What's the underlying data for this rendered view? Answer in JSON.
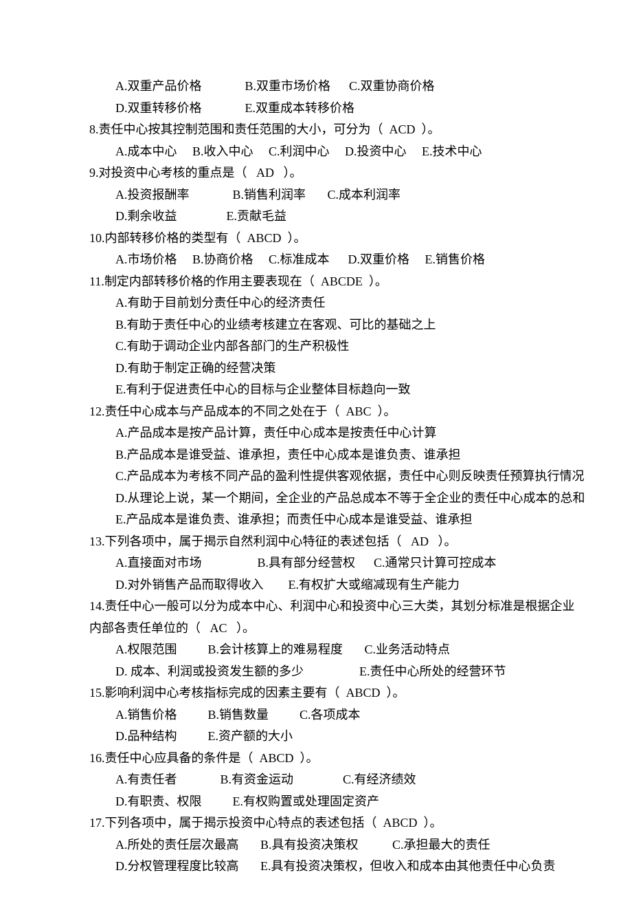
{
  "lines": [
    {
      "indent": true,
      "text": "A.双重产品价格              B.双重市场价格      C.双重协商价格"
    },
    {
      "indent": true,
      "text": "D.双重转移价格              E.双重成本转移价格"
    },
    {
      "indent": false,
      "text": "8.责任中心按其控制范围和责任范围的大小，可分为（  ACD  ）。"
    },
    {
      "indent": true,
      "text": "A.成本中心     B.收入中心     C.利润中心     D.投资中心     E.技术中心"
    },
    {
      "indent": false,
      "text": "9.对投资中心考核的重点是（   AD   ）。"
    },
    {
      "indent": true,
      "text": "A.投资报酬率              B.销售利润率       C.成本利润率"
    },
    {
      "indent": true,
      "text": "D.剩余收益                E.贡献毛益"
    },
    {
      "indent": false,
      "text": "10.内部转移价格的类型有（  ABCD  ）。"
    },
    {
      "indent": true,
      "text": "A.市场价格     B.协商价格     C.标准成本      D.双重价格     E.销售价格"
    },
    {
      "indent": false,
      "text": "11.制定内部转移价格的作用主要表现在（  ABCDE  ）。"
    },
    {
      "indent": true,
      "text": "A.有助于目前划分责任中心的经济责任"
    },
    {
      "indent": true,
      "text": "B.有助于责任中心的业绩考核建立在客观、可比的基础之上"
    },
    {
      "indent": true,
      "text": "C.有助于调动企业内部各部门的生产积极性"
    },
    {
      "indent": true,
      "text": "D.有助于制定正确的经营决策"
    },
    {
      "indent": true,
      "text": "E.有利于促进责任中心的目标与企业整体目标趋向一致"
    },
    {
      "indent": false,
      "text": "12.责任中心成本与产品成本的不同之处在于（  ABC  ）。"
    },
    {
      "indent": true,
      "text": "A.产品成本是按产品计算，责任中心成本是按责任中心计算"
    },
    {
      "indent": true,
      "text": "B.产品成本是谁受益、谁承担，责任中心成本是谁负责、谁承担"
    },
    {
      "indent": true,
      "text": "C.产品成本为考核不同产品的盈利性提供客观依据，责任中心则反映责任预算执行情况"
    },
    {
      "indent": true,
      "text": "D.从理论上说，某一个期间，全企业的产品总成本不等于全企业的责任中心成本的总和"
    },
    {
      "indent": true,
      "text": "E.产品成本是谁负责、谁承担；而责任中心成本是谁受益、谁承担"
    },
    {
      "indent": false,
      "text": "13.下列各项中，属于揭示自然利润中心特征的表述包括（   AD   ）。"
    },
    {
      "indent": true,
      "text": "A.直接面对市场                  B.具有部分经营权      C.通常只计算可控成本"
    },
    {
      "indent": true,
      "text": "D.对外销售产品而取得收入        E.有权扩大或缩减现有生产能力"
    },
    {
      "indent": false,
      "text": "14.责任中心一般可以分为成本中心、利润中心和投资中心三大类，其划分标准是根据企业"
    },
    {
      "indent": false,
      "text": "内部各责任单位的（   AC   ）。"
    },
    {
      "indent": true,
      "text": "A.权限范围          B.会计核算上的难易程度       C.业务活动特点"
    },
    {
      "indent": true,
      "text": "D. 成本、利润或投资发生额的多少                  E.责任中心所处的经营环节"
    },
    {
      "indent": false,
      "text": "15.影响利润中心考核指标完成的因素主要有（  ABCD  ）。"
    },
    {
      "indent": true,
      "text": "A.销售价格          B.销售数量          C.各项成本"
    },
    {
      "indent": true,
      "text": "D.品种结构          E.资产额的大小"
    },
    {
      "indent": false,
      "text": "16.责任中心应具备的条件是（  ABCD  ）。"
    },
    {
      "indent": true,
      "text": "A.有责任者              B.有资金运动                C.有经济绩效"
    },
    {
      "indent": true,
      "text": "D.有职责、权限          E.有权购置或处理固定资产"
    },
    {
      "indent": false,
      "text": "17.下列各项中，属于揭示投资中心特点的表述包括（  ABCD  ）。"
    },
    {
      "indent": true,
      "text": "A.所处的责任层次最高       B.具有投资决策权           C.承担最大的责任"
    },
    {
      "indent": true,
      "text": "D.分权管理程度比较高       E.具有投资决策权，但收入和成本由其他责任中心负责"
    }
  ]
}
